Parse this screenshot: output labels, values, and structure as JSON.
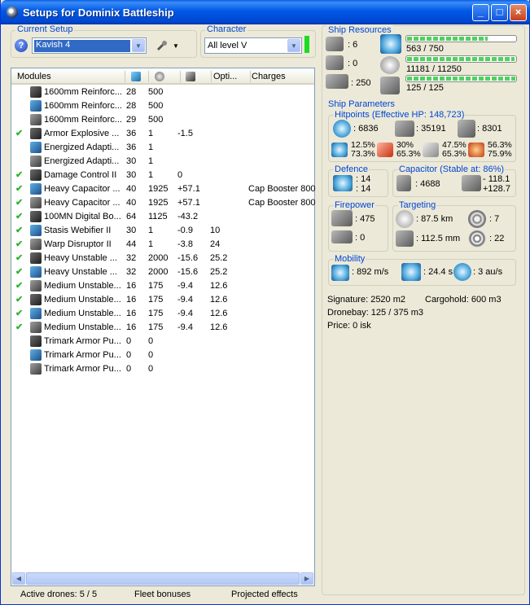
{
  "window": {
    "title": "Setups for Dominix Battleship",
    "controls": {
      "minimize": "_",
      "maximize": "□",
      "close": "×"
    }
  },
  "current_setup": {
    "label": "Current Setup",
    "value": "Kavish 4",
    "help_icon": "?",
    "tool_icon": "tool-dropdown-icon"
  },
  "character": {
    "label": "Character",
    "value": "All level V",
    "status_color": "#1ddc22"
  },
  "modules_list": {
    "columns": {
      "name": "Modules",
      "cpu_icon": "cpu-icon",
      "power_icon": "powergrid-icon",
      "cap_icon": "capacitor-icon",
      "optimal": "Opti...",
      "charges": "Charges"
    },
    "rows": [
      {
        "checked": false,
        "name": "1600mm Reinforc...",
        "cpu": "28",
        "pg": "500",
        "cap": "",
        "opt": "",
        "charges": ""
      },
      {
        "checked": false,
        "name": "1600mm Reinforc...",
        "cpu": "28",
        "pg": "500",
        "cap": "",
        "opt": "",
        "charges": ""
      },
      {
        "checked": false,
        "name": "1600mm Reinforc...",
        "cpu": "29",
        "pg": "500",
        "cap": "",
        "opt": "",
        "charges": ""
      },
      {
        "checked": true,
        "name": "Armor Explosive ...",
        "cpu": "36",
        "pg": "1",
        "cap": "-1.5",
        "opt": "",
        "charges": ""
      },
      {
        "checked": false,
        "name": "Energized Adapti...",
        "cpu": "36",
        "pg": "1",
        "cap": "",
        "opt": "",
        "charges": ""
      },
      {
        "checked": false,
        "name": "Energized Adapti...",
        "cpu": "30",
        "pg": "1",
        "cap": "",
        "opt": "",
        "charges": ""
      },
      {
        "checked": true,
        "name": "Damage Control II",
        "cpu": "30",
        "pg": "1",
        "cap": "0",
        "opt": "",
        "charges": ""
      },
      {
        "checked": true,
        "name": "Heavy Capacitor ...",
        "cpu": "40",
        "pg": "1925",
        "cap": "+57.1",
        "opt": "",
        "charges": "Cap Booster 800"
      },
      {
        "checked": true,
        "name": "Heavy Capacitor ...",
        "cpu": "40",
        "pg": "1925",
        "cap": "+57.1",
        "opt": "",
        "charges": "Cap Booster 800"
      },
      {
        "checked": true,
        "name": "100MN Digital Bo...",
        "cpu": "64",
        "pg": "1125",
        "cap": "-43.2",
        "opt": "",
        "charges": ""
      },
      {
        "checked": true,
        "name": "Stasis Webifier II",
        "cpu": "30",
        "pg": "1",
        "cap": "-0.9",
        "opt": "10",
        "charges": ""
      },
      {
        "checked": true,
        "name": "Warp Disruptor II",
        "cpu": "44",
        "pg": "1",
        "cap": "-3.8",
        "opt": "24",
        "charges": ""
      },
      {
        "checked": true,
        "name": "Heavy Unstable ...",
        "cpu": "32",
        "pg": "2000",
        "cap": "-15.6",
        "opt": "25.2",
        "charges": ""
      },
      {
        "checked": true,
        "name": "Heavy Unstable ...",
        "cpu": "32",
        "pg": "2000",
        "cap": "-15.6",
        "opt": "25.2",
        "charges": ""
      },
      {
        "checked": true,
        "name": "Medium Unstable...",
        "cpu": "16",
        "pg": "175",
        "cap": "-9.4",
        "opt": "12.6",
        "charges": ""
      },
      {
        "checked": true,
        "name": "Medium Unstable...",
        "cpu": "16",
        "pg": "175",
        "cap": "-9.4",
        "opt": "12.6",
        "charges": ""
      },
      {
        "checked": true,
        "name": "Medium Unstable...",
        "cpu": "16",
        "pg": "175",
        "cap": "-9.4",
        "opt": "12.6",
        "charges": ""
      },
      {
        "checked": true,
        "name": "Medium Unstable...",
        "cpu": "16",
        "pg": "175",
        "cap": "-9.4",
        "opt": "12.6",
        "charges": ""
      },
      {
        "checked": false,
        "name": "Trimark Armor Pu...",
        "cpu": "0",
        "pg": "0",
        "cap": "",
        "opt": "",
        "charges": ""
      },
      {
        "checked": false,
        "name": "Trimark Armor Pu...",
        "cpu": "0",
        "pg": "0",
        "cap": "",
        "opt": "",
        "charges": ""
      },
      {
        "checked": false,
        "name": "Trimark Armor Pu...",
        "cpu": "0",
        "pg": "0",
        "cap": "",
        "opt": "",
        "charges": ""
      }
    ]
  },
  "bottom_bar": {
    "active_drones": "Active drones: 5 / 5",
    "fleet_bonuses": "Fleet bonuses",
    "projected_effects": "Projected effects"
  },
  "ship_resources": {
    "label": "Ship Resources",
    "turret_slots": ": 6",
    "launcher_slots": ": 0",
    "drone_bandwidth": ": 250",
    "cpu": {
      "text": "563 / 750",
      "fraction": 0.75
    },
    "powergrid": {
      "text": "11181 / 11250",
      "fraction": 0.99
    },
    "calibration": {
      "text": "125 / 125",
      "fraction": 1.0
    }
  },
  "ship_parameters": {
    "label": "Ship Parameters",
    "hitpoints": {
      "label": "Hitpoints (Effective HP: 148,723)",
      "shield": ": 6836",
      "armor": ": 35191",
      "structure": ": 8301",
      "resists": [
        {
          "a": "12.5%",
          "b": "73.3%"
        },
        {
          "a": "30%",
          "b": "65.3%"
        },
        {
          "a": "47.5%",
          "b": "65.3%"
        },
        {
          "a": "56.3%",
          "b": "75.9%"
        }
      ]
    },
    "defence": {
      "label": "Defence",
      "a": ": 14",
      "b": ": 14"
    },
    "capacitor": {
      "label": "Capacitor (Stable at: 86%)",
      "amount": ": 4688",
      "delta_a": "- 118.1",
      "delta_b": "+128.7"
    },
    "firepower": {
      "label": "Firepower",
      "turret_dps": ": 475",
      "missile_dps": ": 0"
    },
    "targeting": {
      "label": "Targeting",
      "range": ": 87.5 km",
      "max_targets": ": 7",
      "scan_res": ": 112.5 mm",
      "sensor": ": 22"
    },
    "mobility": {
      "label": "Mobility",
      "speed": ": 892 m/s",
      "align": ": 24.4 s",
      "warp": ": 3 au/s"
    },
    "signature": "Signature: 2520 m2",
    "cargohold": "Cargohold: 600 m3",
    "dronebay": "Dronebay: 125 / 375 m3",
    "price": "Price: 0 isk"
  }
}
